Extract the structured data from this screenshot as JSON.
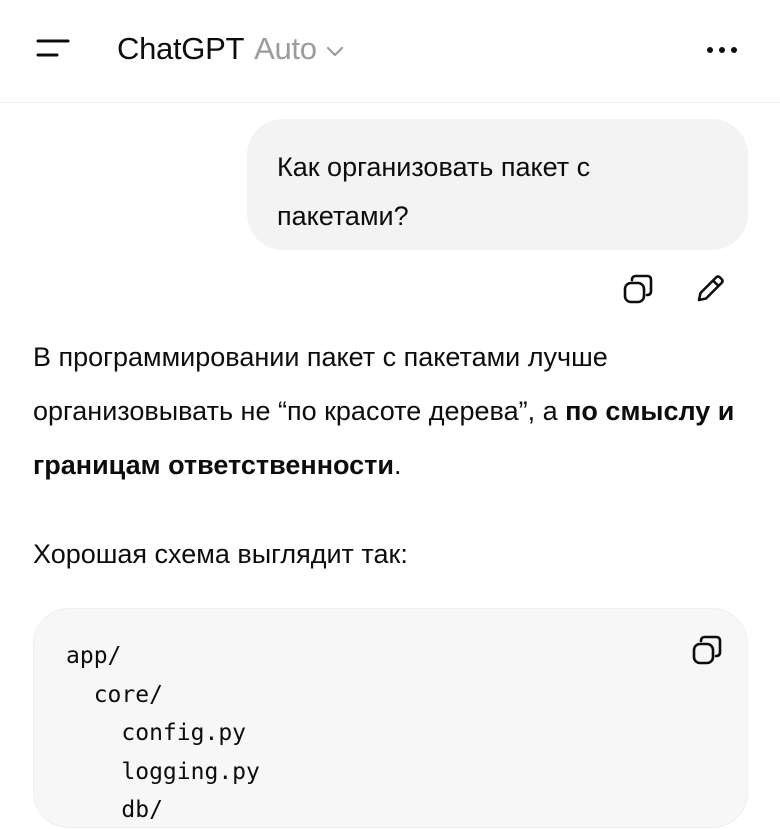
{
  "header": {
    "app_name": "ChatGPT",
    "model_label": "Auto",
    "menu_icon": "menu-icon",
    "chevron_icon": "chevron-down-icon",
    "more_icon": "more-horizontal-icon"
  },
  "conversation": {
    "user_message": "Как организовать пакет с пакетами?",
    "user_actions": {
      "copy_icon": "copy-icon",
      "edit_icon": "pencil-icon"
    },
    "assistant": {
      "para1_text": "В программировании пакет с пакетами лучше организовывать не “по красоте дерева”, а ",
      "para1_bold": "по смыслу и границам ответственности",
      "para1_end": ".",
      "para2_text": "Хорошая схема выглядит так:",
      "code_copy_icon": "copy-icon",
      "code_lines": [
        "app/",
        "  core/",
        "    config.py",
        "    logging.py",
        "    db/"
      ]
    }
  },
  "colors": {
    "background": "#ffffff",
    "bubble": "#f3f3f3",
    "code_bg": "#f7f7f7",
    "muted_text": "#9b9b9b",
    "text": "#0d0d0d"
  }
}
